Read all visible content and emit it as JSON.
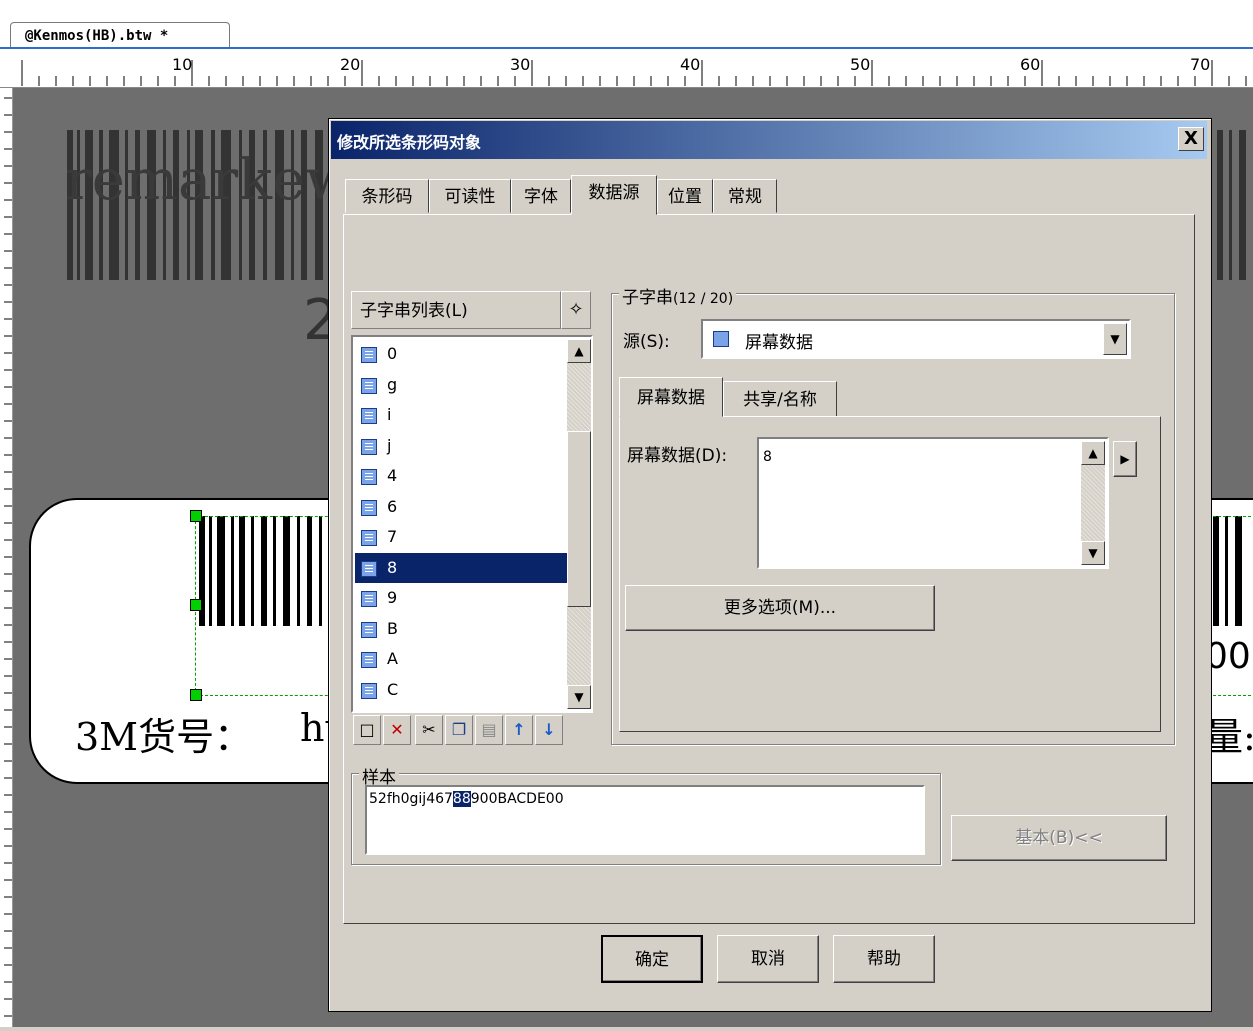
{
  "document": {
    "tab_title": "@Kenmos(HB).btw *"
  },
  "ruler": {
    "labels": [
      "10",
      "20",
      "30",
      "40",
      "50",
      "60",
      "70"
    ]
  },
  "background_label": {
    "text_1": "remarkew",
    "text_2": "2",
    "text_3": "3M货号：",
    "text_4": "hu",
    "text_5": "00",
    "text_6": "量:"
  },
  "dialog": {
    "title": "修改所选条形码对象",
    "close_label": "X",
    "tabs": [
      {
        "label": "条形码"
      },
      {
        "label": "可读性"
      },
      {
        "label": "字体"
      },
      {
        "label": "数据源"
      },
      {
        "label": "位置"
      },
      {
        "label": "常规"
      }
    ],
    "substring_list": {
      "header": "子字串列表(L)",
      "items": [
        "0",
        "g",
        "i",
        "j",
        "4",
        "6",
        "7",
        "8",
        "9",
        "B",
        "A",
        "C"
      ],
      "selected": "8"
    },
    "substring_group": {
      "label": "子字串",
      "count": "(12 / 20)",
      "source_label": "源(S):",
      "source_value": "屏幕数据",
      "inner_tabs": [
        {
          "label": "屏幕数据"
        },
        {
          "label": "共享/名称"
        }
      ],
      "screen_data_label": "屏幕数据(D):",
      "screen_data_value": "8",
      "more_options": "更多选项(M)..."
    },
    "sample": {
      "label": "样本",
      "text_before": "52fh0gij467",
      "text_highlight": "88",
      "text_after": "900BACDE00"
    },
    "basic_button": "基本(B)<<",
    "buttons": {
      "ok": "确定",
      "cancel": "取消",
      "help": "帮助"
    }
  }
}
